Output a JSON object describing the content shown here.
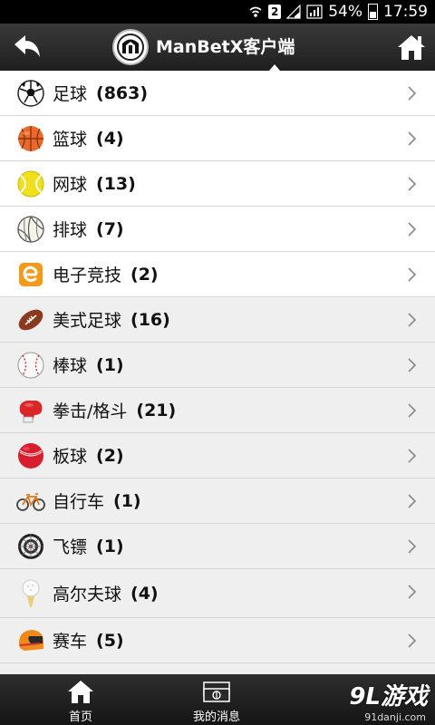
{
  "status_bar": {
    "sim_slot": "2",
    "battery": "54%",
    "time": "17:59"
  },
  "header": {
    "title": "ManBetX客户端"
  },
  "sports": [
    {
      "label": "足球",
      "count": "(863)",
      "icon": "soccer-ball-icon"
    },
    {
      "label": "篮球",
      "count": "(4)",
      "icon": "basketball-icon"
    },
    {
      "label": "网球",
      "count": "(13)",
      "icon": "tennis-ball-icon"
    },
    {
      "label": "排球",
      "count": "(7)",
      "icon": "volleyball-icon"
    },
    {
      "label": "电子竞技",
      "count": "(2)",
      "icon": "esports-icon"
    },
    {
      "label": "美式足球",
      "count": "(16)",
      "icon": "american-football-icon"
    },
    {
      "label": "棒球",
      "count": "(1)",
      "icon": "baseball-icon"
    },
    {
      "label": "拳击/格斗",
      "count": "(21)",
      "icon": "boxing-glove-icon"
    },
    {
      "label": "板球",
      "count": "(2)",
      "icon": "cricket-ball-icon"
    },
    {
      "label": "自行车",
      "count": "(1)",
      "icon": "bicycle-icon"
    },
    {
      "label": "飞镖",
      "count": "(1)",
      "icon": "dartboard-icon"
    },
    {
      "label": "高尔夫球",
      "count": "(4)",
      "icon": "golf-ball-icon"
    },
    {
      "label": "赛车",
      "count": "(5)",
      "icon": "racing-helmet-icon"
    }
  ],
  "bottom_nav": {
    "home": "首页",
    "messages": "我的消息"
  },
  "watermark": {
    "brand": "9L游戏",
    "url": "91danji.com"
  },
  "colors": {
    "header_bg": "#2a2a2a",
    "row_white": "#ffffff",
    "row_gray": "#efefef"
  }
}
